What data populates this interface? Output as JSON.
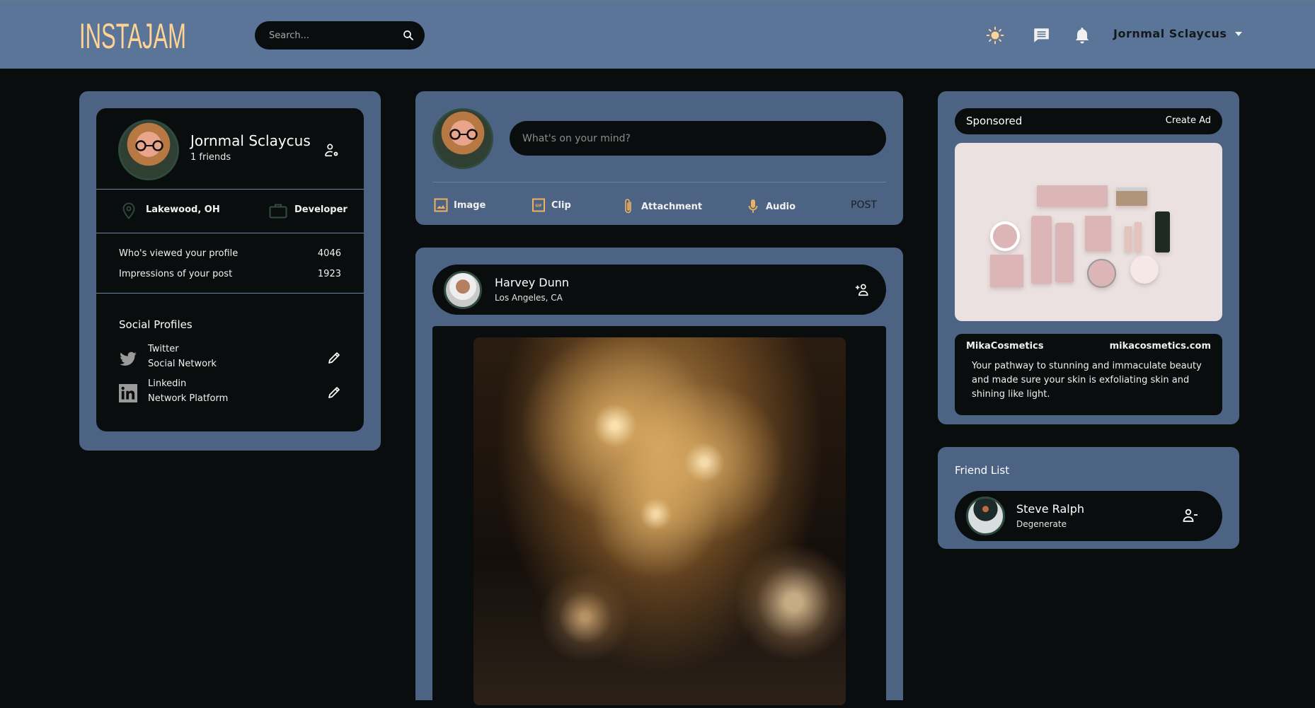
{
  "header": {
    "logo": "INSTAJAM",
    "search_placeholder": "Search...",
    "icons": [
      "sun-icon",
      "message-icon",
      "bell-icon"
    ],
    "user_name": "Jornmal Sclaycus",
    "accent_color": "#ffd394",
    "bar_color": "#5b7599"
  },
  "profile": {
    "name": "Jornmal Sclaycus",
    "friends": "1 friends",
    "location": "Lakewood, OH",
    "occupation": "Developer",
    "stats": [
      {
        "label": "Who's viewed your profile",
        "value": "4046"
      },
      {
        "label": "Impressions of your post",
        "value": "1923"
      }
    ],
    "social_title": "Social Profiles",
    "socials": [
      {
        "name": "Twitter",
        "desc": "Social Network",
        "icon": "twitter-icon"
      },
      {
        "name": "Linkedin",
        "desc": "Network Platform",
        "icon": "linkedin-icon"
      }
    ]
  },
  "composer": {
    "placeholder": "What's on your mind?",
    "actions": [
      {
        "label": "Image",
        "icon": "image-icon"
      },
      {
        "label": "Clip",
        "icon": "gif-icon"
      },
      {
        "label": "Attachment",
        "icon": "paperclip-icon"
      },
      {
        "label": "Audio",
        "icon": "microphone-icon"
      }
    ],
    "post_label": "POST"
  },
  "post": {
    "author": "Harvey Dunn",
    "location": "Los Angeles, CA",
    "image_alt": "Golden fireworks"
  },
  "sponsored": {
    "title": "Sponsored",
    "create_ad": "Create Ad",
    "brand": "MikaCosmetics",
    "url": "mikacosmetics.com",
    "description": "Your pathway to stunning and immaculate beauty and made sure your skin is exfoliating skin and shining like light."
  },
  "friend_list": {
    "title": "Friend List",
    "friends": [
      {
        "name": "Steve Ralph",
        "desc": "Degenerate"
      }
    ]
  }
}
